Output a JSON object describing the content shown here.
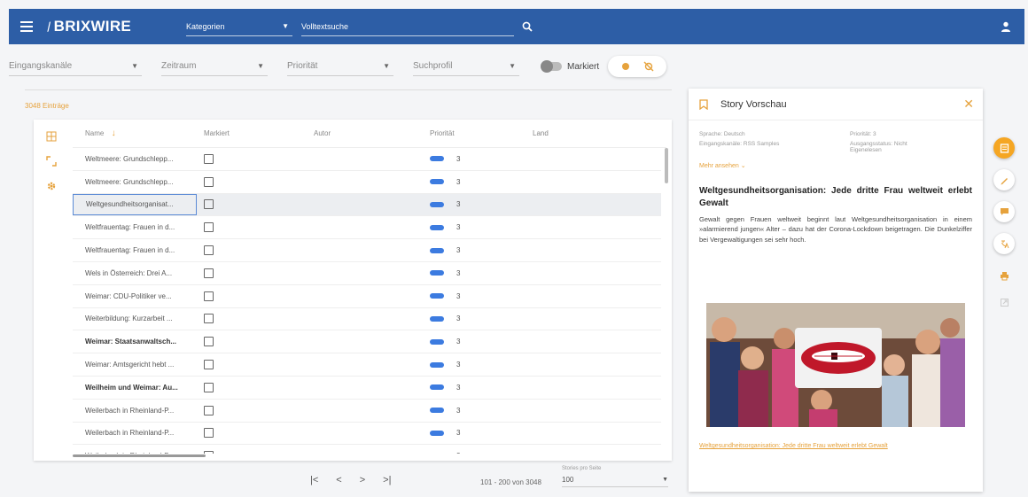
{
  "header": {
    "app_name": "BRIXWIRE",
    "category_select": "Kategorien",
    "search_placeholder": "Volltextsuche"
  },
  "filters": {
    "channels": "Eingangskanäle",
    "period": "Zeitraum",
    "priority": "Priorität",
    "search_profile": "Suchprofil",
    "marked_toggle": "Markiert"
  },
  "list": {
    "entries_count": "3048 Einträge",
    "columns": {
      "name": "Name",
      "marked": "Markiert",
      "author": "Autor",
      "priority": "Priorität",
      "country": "Land"
    },
    "rows": [
      {
        "name": "Weltmeere: Grundschlepp...",
        "priority": "3",
        "bold": false,
        "selected": false
      },
      {
        "name": "Weltmeere: Grundschlepp...",
        "priority": "3",
        "bold": false,
        "selected": false
      },
      {
        "name": "Weltgesundheitsorganisat...",
        "priority": "3",
        "bold": false,
        "selected": true
      },
      {
        "name": "Weltfrauentag: Frauen in d...",
        "priority": "3",
        "bold": false,
        "selected": false
      },
      {
        "name": "Weltfrauentag: Frauen in d...",
        "priority": "3",
        "bold": false,
        "selected": false
      },
      {
        "name": "Wels in Österreich: Drei A...",
        "priority": "3",
        "bold": false,
        "selected": false
      },
      {
        "name": "Weimar: CDU-Politiker ve...",
        "priority": "3",
        "bold": false,
        "selected": false
      },
      {
        "name": "Weiterbildung: Kurzarbeit ...",
        "priority": "3",
        "bold": false,
        "selected": false
      },
      {
        "name": "Weimar: Staatsanwaltsch...",
        "priority": "3",
        "bold": true,
        "selected": false
      },
      {
        "name": "Weimar: Amtsgericht hebt ...",
        "priority": "3",
        "bold": false,
        "selected": false
      },
      {
        "name": "Weilheim und Weimar: Au...",
        "priority": "3",
        "bold": true,
        "selected": false
      },
      {
        "name": "Weilerbach in Rheinland-P...",
        "priority": "3",
        "bold": false,
        "selected": false
      },
      {
        "name": "Weilerbach in Rheinland-P...",
        "priority": "3",
        "bold": false,
        "selected": false
      },
      {
        "name": "Weilerbach in Rheinland-P...",
        "priority": "3",
        "bold": false,
        "selected": false
      }
    ]
  },
  "pagination": {
    "first": "|<",
    "prev": "<",
    "next": ">",
    "last": ">|",
    "range": "101 - 200 von 3048",
    "per_page_label": "Stories pro Seite",
    "per_page_value": "100"
  },
  "preview": {
    "title": "Story Vorschau",
    "language": "Sprache: Deutsch",
    "priority": "Priorität: 3",
    "channel": "Eingangskanäle: RSS Samples",
    "output_status": "Ausgangsstatus: Nicht",
    "output_status_2": "Eigenelesen",
    "show_more": "Mehr ansehen",
    "headline": "Weltgesundheitsorganisation: Jede dritte Frau weltweit erlebt Gewalt",
    "teaser": "Gewalt gegen Frauen weltweit beginnt laut Weltgesundheitsorganisation in einem »alarmierend jungen« Alter – dazu hat der Corona-Lockdown beigetragen. Die Dunkelziffer bei Vergewaltigungen sei sehr hoch.",
    "link": "Weltgesundheitsorganisation: Jede dritte Frau weltweit erlebt Gewalt"
  },
  "colors": {
    "header_bg": "#2d5ea6",
    "accent": "#e6a23c",
    "priority_bar": "#3c7be0"
  }
}
